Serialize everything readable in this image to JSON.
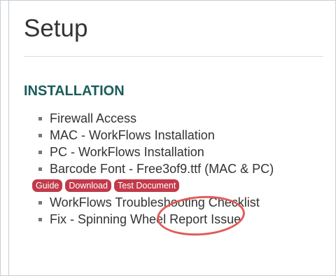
{
  "page": {
    "title": "Setup"
  },
  "section": {
    "title": "INSTALLATION"
  },
  "items": [
    {
      "label": "Firewall Access"
    },
    {
      "label": "MAC - WorkFlows Installation"
    },
    {
      "label": "PC - WorkFlows Installation"
    },
    {
      "label": "Barcode Font - Free3of9.ttf (MAC & PC)"
    },
    {
      "label": "WorkFlows Troubleshooting Checklist"
    },
    {
      "label": "Fix - Spinning Wheel Report Issue"
    }
  ],
  "badges": [
    {
      "label": "Guide"
    },
    {
      "label": "Download"
    },
    {
      "label": "Test Document"
    }
  ],
  "colors": {
    "section_title": "#1a5d5a",
    "badge_background": "#c23a4a",
    "annotation": "#e35a5a"
  }
}
